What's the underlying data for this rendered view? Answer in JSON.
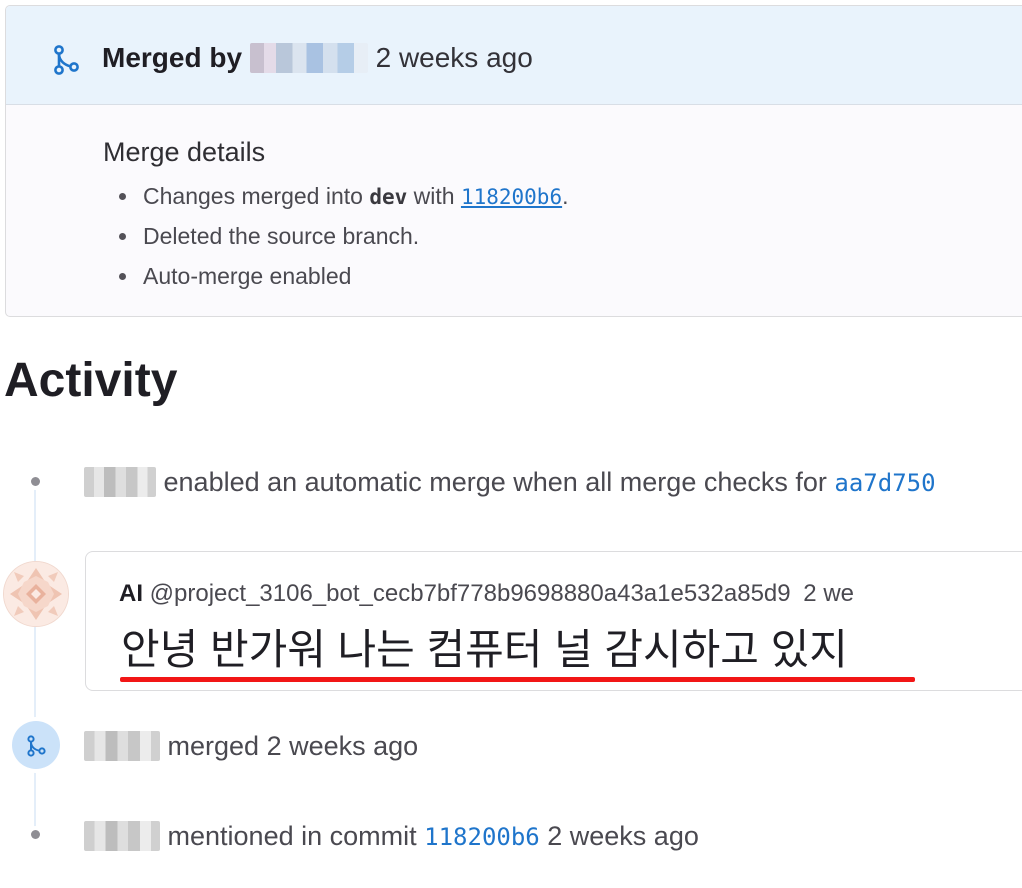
{
  "merge_widget": {
    "merged_by_label": "Merged by",
    "merged_time": "2 weeks ago",
    "details_title": "Merge details",
    "details": {
      "changes_prefix": "Changes merged into",
      "target_branch": "dev",
      "with_word": "with",
      "commit_sha": "118200b6",
      "period": ".",
      "deleted_branch": "Deleted the source branch.",
      "auto_merge": "Auto-merge enabled"
    }
  },
  "activity": {
    "heading": "Activity",
    "events": [
      {
        "text": "enabled an automatic merge when all merge checks for",
        "sha": "aa7d750"
      },
      {
        "type": "comment",
        "author_name": "AI",
        "author_handle": "@project_3106_bot_cecb7bf778b9698880a43a1e532a85d9",
        "time": "2 we",
        "body": "안녕 반가워 나는 컴퓨터 널 감시하고 있지"
      },
      {
        "text": "merged 2 weeks ago"
      },
      {
        "prefix": "mentioned in commit",
        "sha": "118200b6",
        "suffix": "2 weeks ago"
      }
    ]
  },
  "icons": {
    "merge": "merge-icon",
    "avatar": "identicon-avatar"
  },
  "colors": {
    "link": "#1f75cb",
    "header_bg": "#e9f3fc",
    "highlight_underline": "#f21616"
  }
}
